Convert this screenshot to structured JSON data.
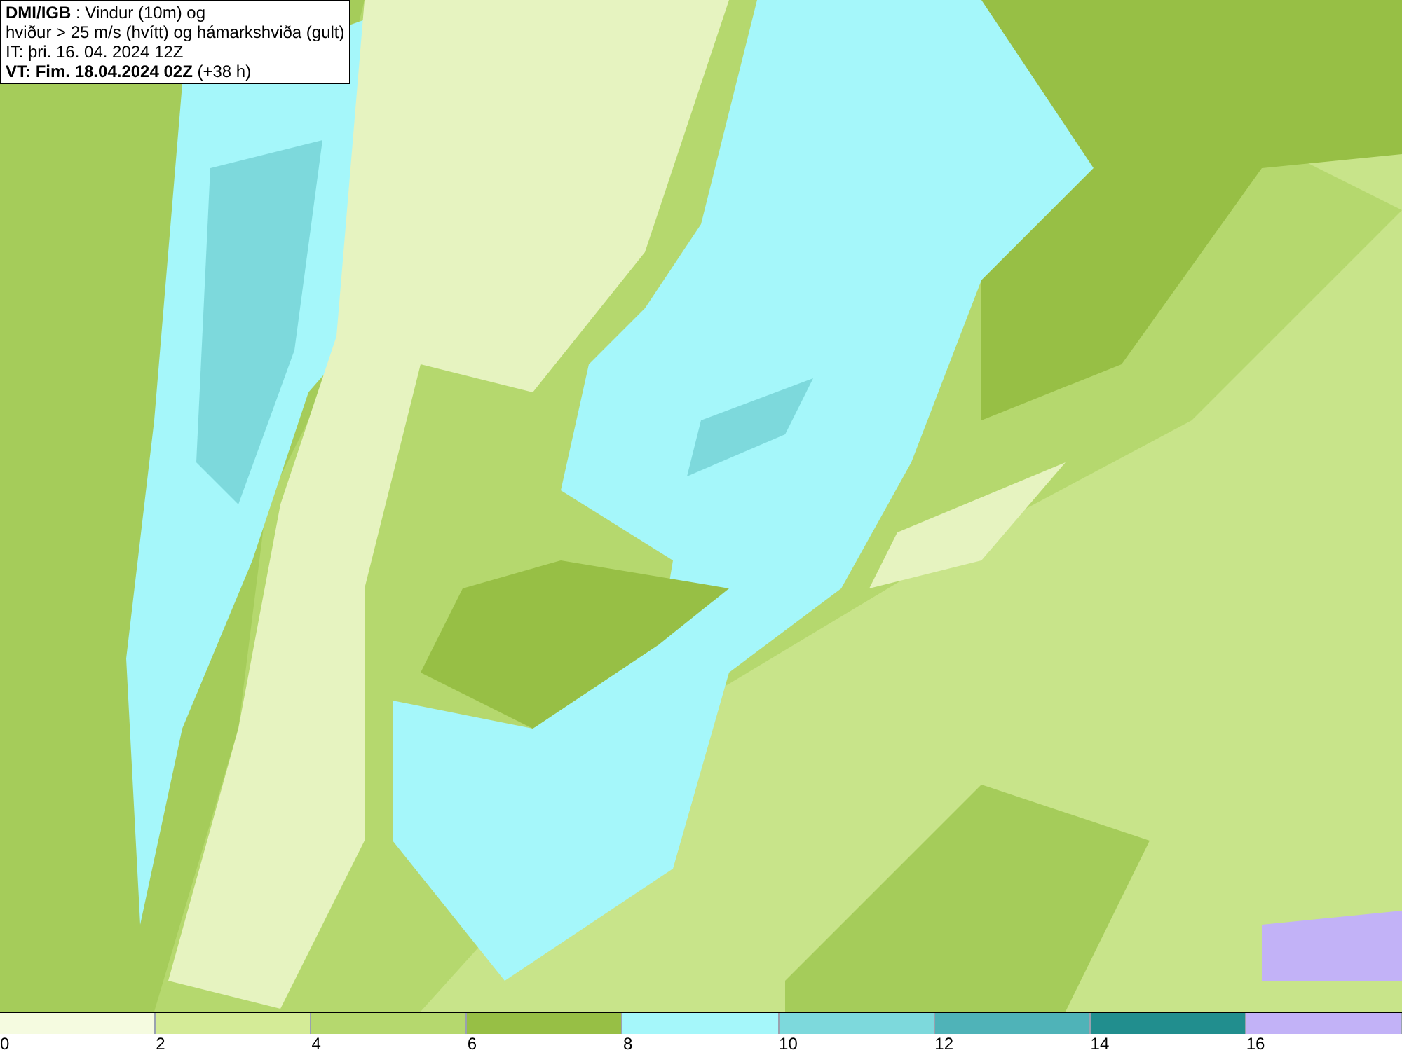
{
  "header": {
    "lines": [
      "**DMI/IGB** : Vindur (10m) og",
      "hviður > 25 m/s (hvítt) og hámarkshviða (gult)",
      "IT: þri. 16. 04. 2024 12Z",
      "**VT: Fim. 18.04.2024 02Z** (+38 h)"
    ]
  },
  "legend": [
    {
      "label": "0",
      "color": "#f5fbe0"
    },
    {
      "label": "2",
      "color": "#d4eb97"
    },
    {
      "label": "4",
      "color": "#b5d86e"
    },
    {
      "label": "6",
      "color": "#97bf45"
    },
    {
      "label": "8",
      "color": "#a5f7fa"
    },
    {
      "label": "10",
      "color": "#7dd9dc"
    },
    {
      "label": "12",
      "color": "#4fb3b8"
    },
    {
      "label": "14",
      "color": "#218e8e"
    },
    {
      "label": "16",
      "color": "#c2b2f7"
    }
  ]
}
